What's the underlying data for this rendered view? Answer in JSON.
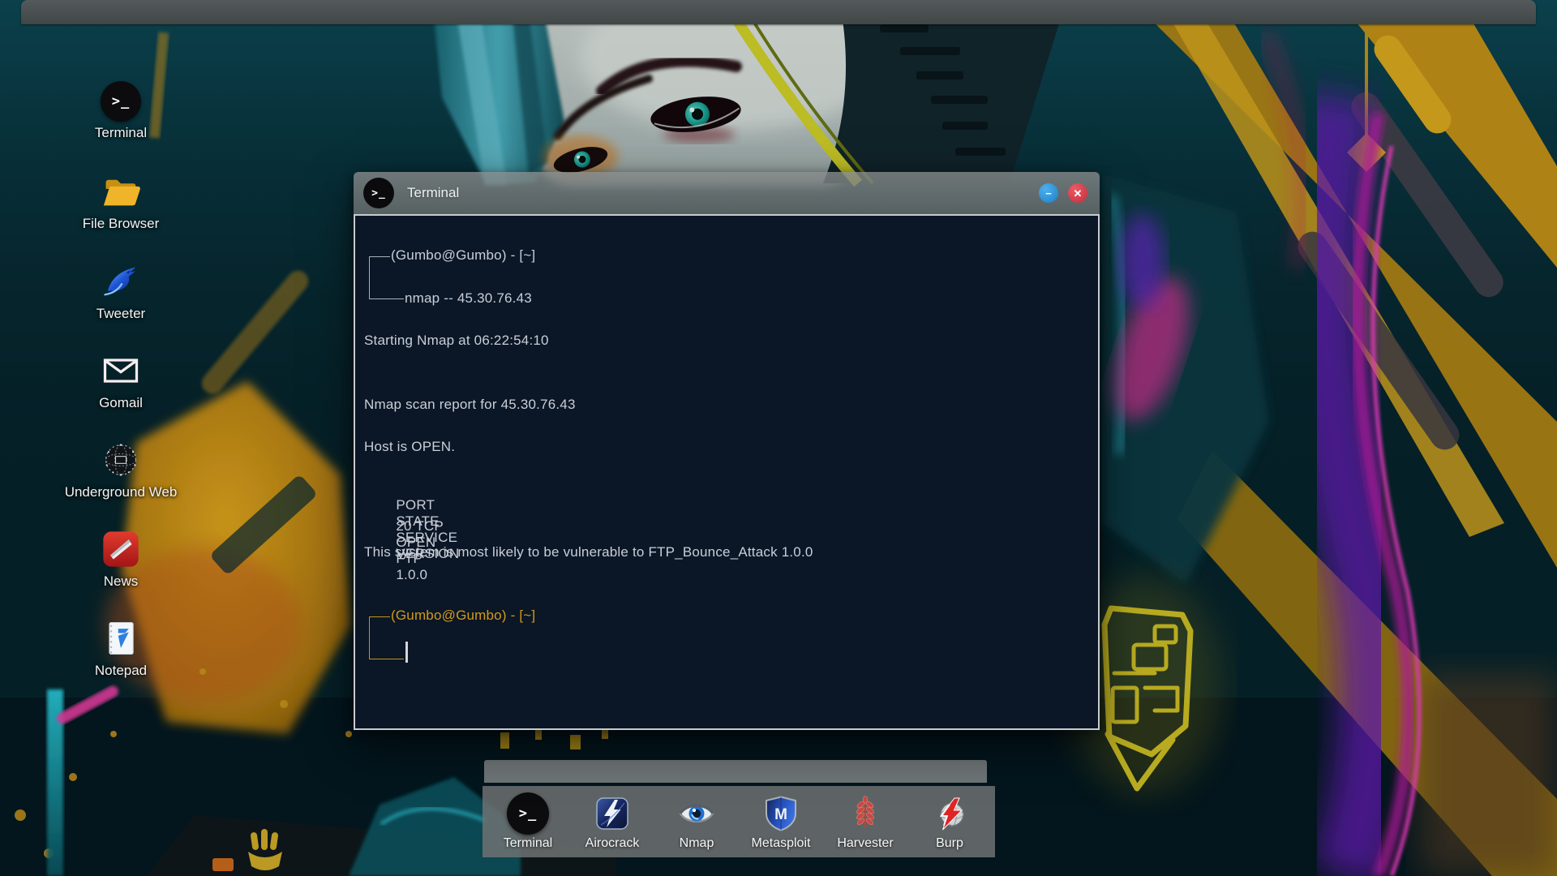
{
  "glyphs": {
    "terminal": ">_",
    "metasploit": "M"
  },
  "desktop": {
    "icons": [
      {
        "label": "Terminal"
      },
      {
        "label": "File Browser"
      },
      {
        "label": "Tweeter"
      },
      {
        "label": "Gomail"
      },
      {
        "label": "Underground Web"
      },
      {
        "label": "News"
      },
      {
        "label": "Notepad"
      }
    ]
  },
  "window": {
    "title": "Terminal",
    "controls": {
      "minimize": "−",
      "close": "✕"
    },
    "terminal": {
      "prompt_user": "(Gumbo@Gumbo) - [~]",
      "command": "nmap -- 45.30.76.43",
      "line_starting": "Starting Nmap at 06:22:54:10",
      "line_report": "Nmap scan report for 45.30.76.43",
      "line_host": "Host is OPEN.",
      "table": {
        "headers": [
          "PORT",
          "STATE",
          "SERVICE",
          "VERSION"
        ],
        "row": [
          "20 TCP",
          "OPEN",
          "FTP",
          "1.0.0"
        ]
      },
      "line_vuln": "This system is most likely to be vulnerable to FTP_Bounce_Attack 1.0.0",
      "prompt2_user": "(Gumbo@Gumbo) - [~]"
    }
  },
  "dock": {
    "items": [
      {
        "label": "Terminal"
      },
      {
        "label": "Airocrack"
      },
      {
        "label": "Nmap"
      },
      {
        "label": "Metasploit"
      },
      {
        "label": "Harvester"
      },
      {
        "label": "Burp"
      }
    ]
  },
  "colors": {
    "prompt_orange": "#d19a1b",
    "terminal_bg": "#0b1626",
    "terminal_text": "#c9cfd8",
    "titlebar_gray": "#6c7171",
    "minimize_blue": "#1e93dc",
    "close_red": "#d8414f",
    "wallpaper_gold": "#c9941c",
    "wallpaper_teal": "#0d4a57",
    "neon_magenta": "#e020b8"
  }
}
